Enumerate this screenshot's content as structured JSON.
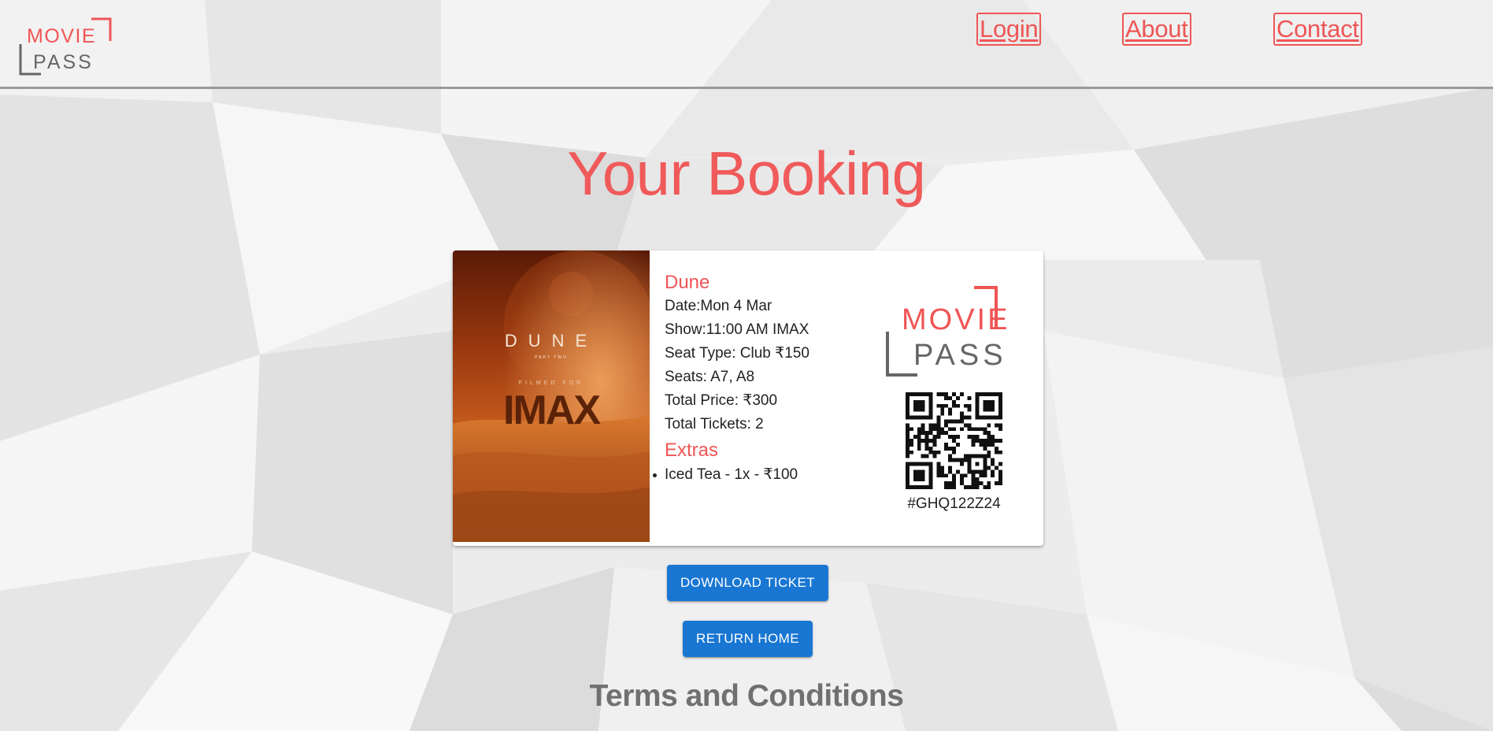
{
  "brand": {
    "logo_word1": "MOVIE",
    "logo_word2": "PASS"
  },
  "nav": {
    "login": "Login",
    "about": "About",
    "contact": "Contact"
  },
  "page_title": "Your Booking",
  "booking": {
    "movie_title": "Dune",
    "date": "Date:Mon 4 Mar",
    "show": "Show:11:00 AM IMAX",
    "seat_type": "Seat Type: Club ₹150",
    "seats": "Seats: A7, A8",
    "total_price": "Total Price: ₹300",
    "total_tickets": "Total Tickets: 2",
    "extras_title": "Extras",
    "extras": [
      "Iced Tea - 1x - ₹100"
    ],
    "booking_code": "#GHQ122Z24"
  },
  "poster": {
    "title": "DUNE",
    "subtitle": "PART TWO",
    "tagline": "FILMED FOR",
    "format": "IMAX"
  },
  "buttons": {
    "download": "Download Ticket",
    "home": "Return Home"
  },
  "terms_title": "Terms and Conditions",
  "colors": {
    "accent": "#f05555",
    "button": "#1976d2",
    "logo_gray": "#666666"
  }
}
